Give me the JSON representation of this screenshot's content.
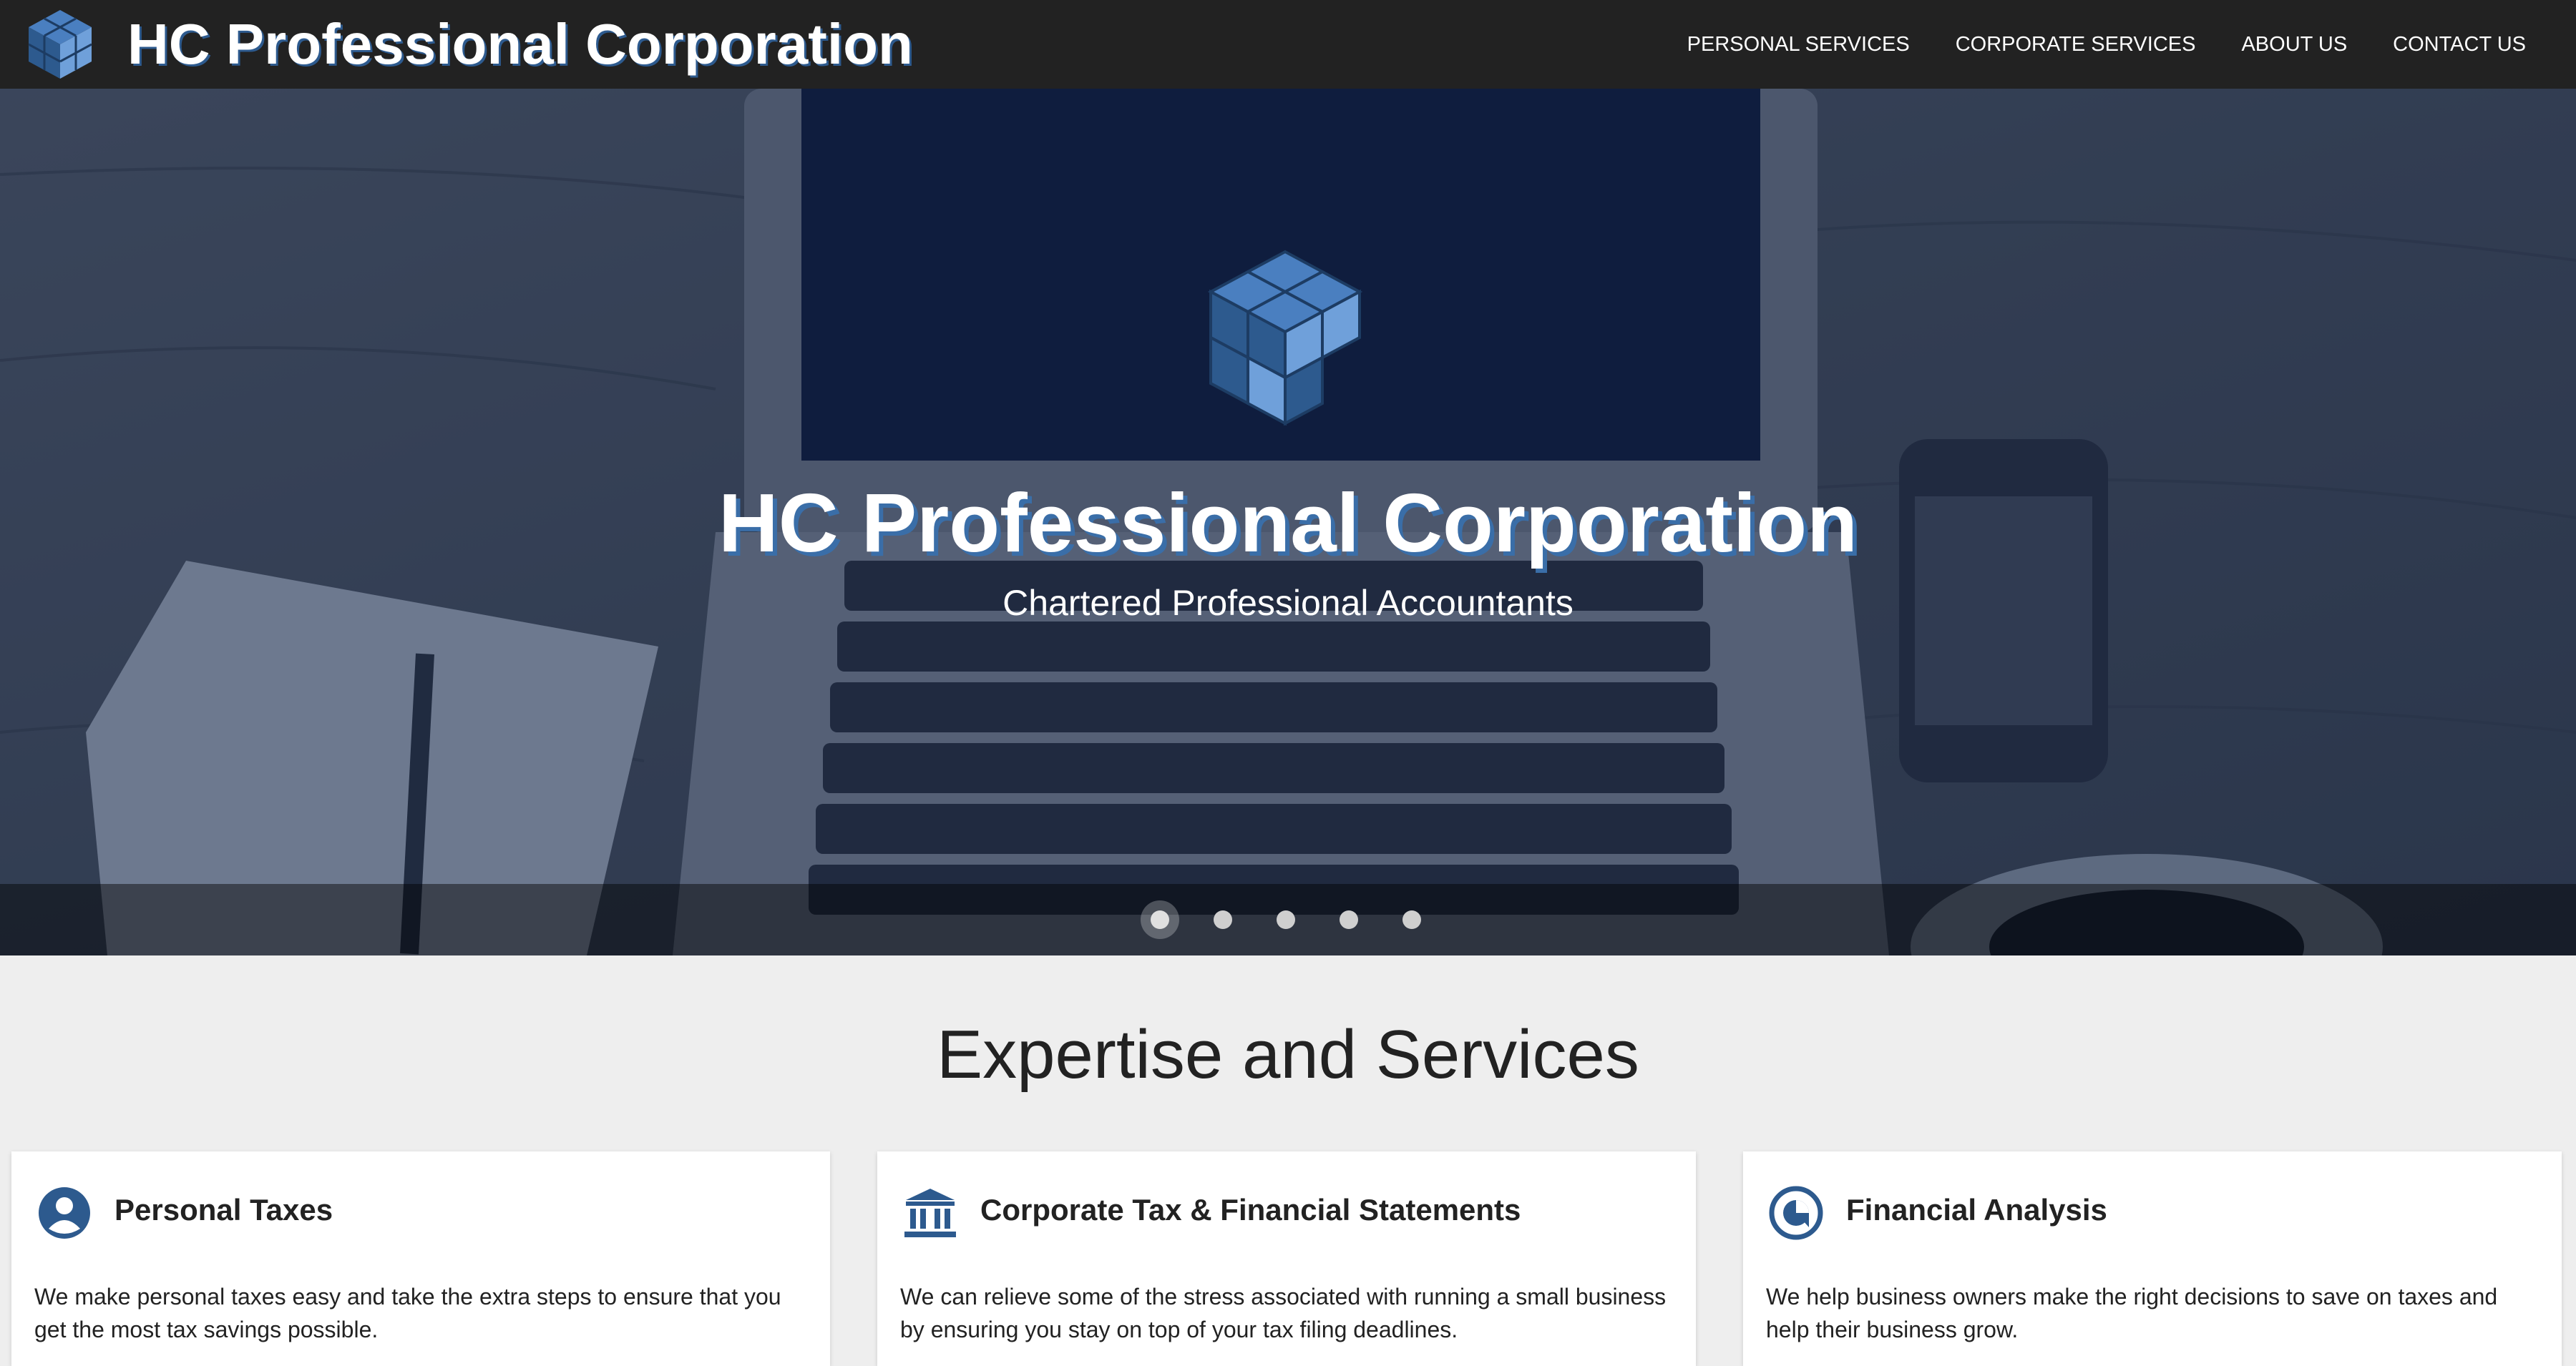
{
  "header": {
    "brand": "HC Professional Corporation",
    "nav": [
      "PERSONAL SERVICES",
      "CORPORATE SERVICES",
      "ABOUT US",
      "CONTACT US"
    ]
  },
  "hero": {
    "title": "HC Professional Corporation",
    "subtitle": "Chartered Professional Accountants",
    "slide_count": 5,
    "active_slide": 1
  },
  "services": {
    "title": "Expertise and Services",
    "cards": [
      {
        "icon": "person-icon",
        "title": "Personal Taxes",
        "text": "We make personal taxes easy and take the extra steps to ensure that you get the most tax savings possible."
      },
      {
        "icon": "bank-icon",
        "title": "Corporate Tax & Financial Statements",
        "text": "We can relieve some of the stress associated with running a small business by ensuring you stay on top of your tax filing deadlines."
      },
      {
        "icon": "pie-chart-icon",
        "title": "Financial Analysis",
        "text": "We help business owners make the right decisions to save on taxes and help their business grow."
      }
    ]
  },
  "colors": {
    "topbar": "#222222",
    "accent_blue": "#2d5a8e",
    "cube_light": "#6fa0da",
    "page_bg": "#eeeeee"
  }
}
